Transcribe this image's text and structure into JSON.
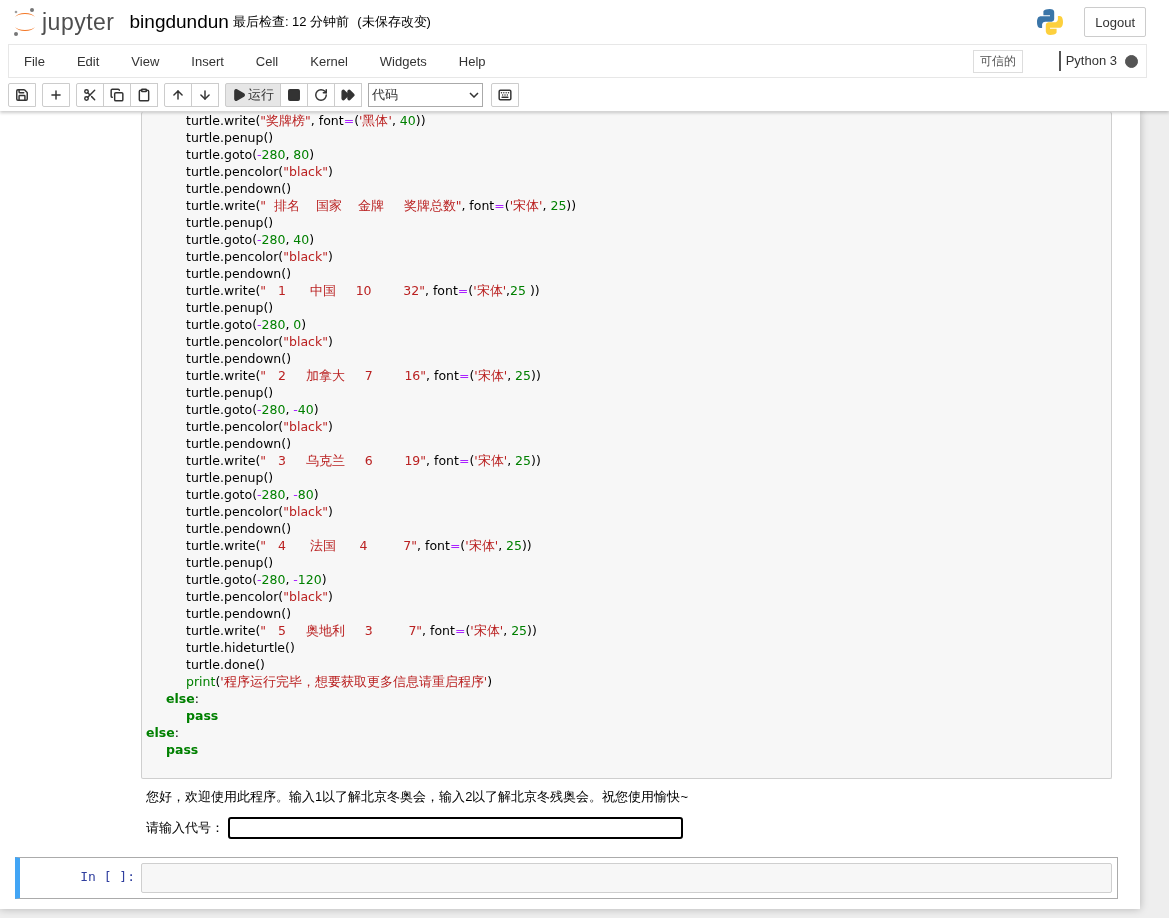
{
  "header": {
    "logo_text": "jupyter",
    "notebook_name": "bingdundun",
    "checkpoint": "最后检查: 12 分钟前",
    "autosave": "(未保存改变)",
    "logout": "Logout"
  },
  "menu": {
    "items": [
      "File",
      "Edit",
      "View",
      "Insert",
      "Cell",
      "Kernel",
      "Widgets",
      "Help"
    ],
    "trusted": "可信的",
    "kernel_name": "Python 3",
    "kernel_busy": true
  },
  "toolbar": {
    "groups": [
      [
        {
          "kind": "save"
        }
      ],
      [
        {
          "kind": "add"
        }
      ],
      [
        {
          "kind": "cut"
        },
        {
          "kind": "copy"
        },
        {
          "kind": "paste"
        }
      ],
      [
        {
          "kind": "up"
        },
        {
          "kind": "down"
        }
      ],
      [
        {
          "kind": "run",
          "label": "运行",
          "hovered": true
        },
        {
          "kind": "stop"
        },
        {
          "kind": "restart"
        },
        {
          "kind": "run-all"
        }
      ]
    ],
    "cell_type": "代码",
    "keyboard": {
      "kind": "keyboard"
    }
  },
  "cells": [
    {
      "selected": false,
      "code": [
        {
          "children": [
            {
              "children": [
                {
                  "tokens": [
                    {
                      "kind": "plain",
                      "t": "turtle.write("
                    },
                    {
                      "kind": "string",
                      "t": "\"奖牌榜\""
                    },
                    {
                      "kind": "plain",
                      "t": ", font"
                    },
                    {
                      "kind": "operator",
                      "t": "="
                    },
                    {
                      "kind": "plain",
                      "t": "("
                    },
                    {
                      "kind": "string",
                      "t": "'黑体'"
                    },
                    {
                      "kind": "plain",
                      "t": ", "
                    },
                    {
                      "kind": "number",
                      "t": "40"
                    },
                    {
                      "kind": "plain",
                      "t": "))"
                    }
                  ]
                },
                {
                  "tokens": [
                    {
                      "kind": "plain",
                      "t": "turtle.penup()"
                    }
                  ]
                },
                {
                  "tokens": [
                    {
                      "kind": "plain",
                      "t": "turtle.goto("
                    },
                    {
                      "kind": "operator",
                      "t": "-"
                    },
                    {
                      "kind": "number",
                      "t": "280"
                    },
                    {
                      "kind": "plain",
                      "t": ", "
                    },
                    {
                      "kind": "number",
                      "t": "80"
                    },
                    {
                      "kind": "plain",
                      "t": ")"
                    }
                  ]
                },
                {
                  "tokens": [
                    {
                      "kind": "plain",
                      "t": "turtle.pencolor("
                    },
                    {
                      "kind": "string",
                      "t": "\"black\""
                    },
                    {
                      "kind": "plain",
                      "t": ")"
                    }
                  ]
                },
                {
                  "tokens": [
                    {
                      "kind": "plain",
                      "t": "turtle.pendown()"
                    }
                  ]
                },
                {
                  "tokens": [
                    {
                      "kind": "plain",
                      "t": "turtle.write("
                    },
                    {
                      "kind": "string",
                      "t": "\"  排名    国家    金牌     奖牌总数\""
                    },
                    {
                      "kind": "plain",
                      "t": ", font"
                    },
                    {
                      "kind": "operator",
                      "t": "="
                    },
                    {
                      "kind": "plain",
                      "t": "("
                    },
                    {
                      "kind": "string",
                      "t": "'宋体'"
                    },
                    {
                      "kind": "plain",
                      "t": ", "
                    },
                    {
                      "kind": "number",
                      "t": "25"
                    },
                    {
                      "kind": "plain",
                      "t": "))"
                    }
                  ]
                },
                {
                  "tokens": [
                    {
                      "kind": "plain",
                      "t": "turtle.penup()"
                    }
                  ]
                },
                {
                  "tokens": [
                    {
                      "kind": "plain",
                      "t": "turtle.goto("
                    },
                    {
                      "kind": "operator",
                      "t": "-"
                    },
                    {
                      "kind": "number",
                      "t": "280"
                    },
                    {
                      "kind": "plain",
                      "t": ", "
                    },
                    {
                      "kind": "number",
                      "t": "40"
                    },
                    {
                      "kind": "plain",
                      "t": ")"
                    }
                  ]
                },
                {
                  "tokens": [
                    {
                      "kind": "plain",
                      "t": "turtle.pencolor("
                    },
                    {
                      "kind": "string",
                      "t": "\"black\""
                    },
                    {
                      "kind": "plain",
                      "t": ")"
                    }
                  ]
                },
                {
                  "tokens": [
                    {
                      "kind": "plain",
                      "t": "turtle.pendown()"
                    }
                  ]
                },
                {
                  "tokens": [
                    {
                      "kind": "plain",
                      "t": "turtle.write("
                    },
                    {
                      "kind": "string",
                      "t": "\"   1      中国     10        32\""
                    },
                    {
                      "kind": "plain",
                      "t": ", font"
                    },
                    {
                      "kind": "operator",
                      "t": "="
                    },
                    {
                      "kind": "plain",
                      "t": "("
                    },
                    {
                      "kind": "string",
                      "t": "'宋体'"
                    },
                    {
                      "kind": "plain",
                      "t": ","
                    },
                    {
                      "kind": "number",
                      "t": "25"
                    },
                    {
                      "kind": "plain",
                      "t": " ))"
                    }
                  ]
                },
                {
                  "tokens": [
                    {
                      "kind": "plain",
                      "t": "turtle.penup()"
                    }
                  ]
                },
                {
                  "tokens": [
                    {
                      "kind": "plain",
                      "t": "turtle.goto("
                    },
                    {
                      "kind": "operator",
                      "t": "-"
                    },
                    {
                      "kind": "number",
                      "t": "280"
                    },
                    {
                      "kind": "plain",
                      "t": ", "
                    },
                    {
                      "kind": "number",
                      "t": "0"
                    },
                    {
                      "kind": "plain",
                      "t": ")"
                    }
                  ]
                },
                {
                  "tokens": [
                    {
                      "kind": "plain",
                      "t": "turtle.pencolor("
                    },
                    {
                      "kind": "string",
                      "t": "\"black\""
                    },
                    {
                      "kind": "plain",
                      "t": ")"
                    }
                  ]
                },
                {
                  "tokens": [
                    {
                      "kind": "plain",
                      "t": "turtle.pendown()"
                    }
                  ]
                },
                {
                  "tokens": [
                    {
                      "kind": "plain",
                      "t": "turtle.write("
                    },
                    {
                      "kind": "string",
                      "t": "\"   2     加拿大     7        16\""
                    },
                    {
                      "kind": "plain",
                      "t": ", font"
                    },
                    {
                      "kind": "operator",
                      "t": "="
                    },
                    {
                      "kind": "plain",
                      "t": "("
                    },
                    {
                      "kind": "string",
                      "t": "'宋体'"
                    },
                    {
                      "kind": "plain",
                      "t": ", "
                    },
                    {
                      "kind": "number",
                      "t": "25"
                    },
                    {
                      "kind": "plain",
                      "t": "))"
                    }
                  ]
                },
                {
                  "tokens": [
                    {
                      "kind": "plain",
                      "t": "turtle.penup()"
                    }
                  ]
                },
                {
                  "tokens": [
                    {
                      "kind": "plain",
                      "t": "turtle.goto("
                    },
                    {
                      "kind": "operator",
                      "t": "-"
                    },
                    {
                      "kind": "number",
                      "t": "280"
                    },
                    {
                      "kind": "plain",
                      "t": ", "
                    },
                    {
                      "kind": "operator",
                      "t": "-"
                    },
                    {
                      "kind": "number",
                      "t": "40"
                    },
                    {
                      "kind": "plain",
                      "t": ")"
                    }
                  ]
                },
                {
                  "tokens": [
                    {
                      "kind": "plain",
                      "t": "turtle.pencolor("
                    },
                    {
                      "kind": "string",
                      "t": "\"black\""
                    },
                    {
                      "kind": "plain",
                      "t": ")"
                    }
                  ]
                },
                {
                  "tokens": [
                    {
                      "kind": "plain",
                      "t": "turtle.pendown()"
                    }
                  ]
                },
                {
                  "tokens": [
                    {
                      "kind": "plain",
                      "t": "turtle.write("
                    },
                    {
                      "kind": "string",
                      "t": "\"   3     乌克兰     6        19\""
                    },
                    {
                      "kind": "plain",
                      "t": ", font"
                    },
                    {
                      "kind": "operator",
                      "t": "="
                    },
                    {
                      "kind": "plain",
                      "t": "("
                    },
                    {
                      "kind": "string",
                      "t": "'宋体'"
                    },
                    {
                      "kind": "plain",
                      "t": ", "
                    },
                    {
                      "kind": "number",
                      "t": "25"
                    },
                    {
                      "kind": "plain",
                      "t": "))"
                    }
                  ]
                },
                {
                  "tokens": [
                    {
                      "kind": "plain",
                      "t": "turtle.penup()"
                    }
                  ]
                },
                {
                  "tokens": [
                    {
                      "kind": "plain",
                      "t": "turtle.goto("
                    },
                    {
                      "kind": "operator",
                      "t": "-"
                    },
                    {
                      "kind": "number",
                      "t": "280"
                    },
                    {
                      "kind": "plain",
                      "t": ", "
                    },
                    {
                      "kind": "operator",
                      "t": "-"
                    },
                    {
                      "kind": "number",
                      "t": "80"
                    },
                    {
                      "kind": "plain",
                      "t": ")"
                    }
                  ]
                },
                {
                  "tokens": [
                    {
                      "kind": "plain",
                      "t": "turtle.pencolor("
                    },
                    {
                      "kind": "string",
                      "t": "\"black\""
                    },
                    {
                      "kind": "plain",
                      "t": ")"
                    }
                  ]
                },
                {
                  "tokens": [
                    {
                      "kind": "plain",
                      "t": "turtle.pendown()"
                    }
                  ]
                },
                {
                  "tokens": [
                    {
                      "kind": "plain",
                      "t": "turtle.write("
                    },
                    {
                      "kind": "string",
                      "t": "\"   4      法国      4         7\""
                    },
                    {
                      "kind": "plain",
                      "t": ", font"
                    },
                    {
                      "kind": "operator",
                      "t": "="
                    },
                    {
                      "kind": "plain",
                      "t": "("
                    },
                    {
                      "kind": "string",
                      "t": "'宋体'"
                    },
                    {
                      "kind": "plain",
                      "t": ", "
                    },
                    {
                      "kind": "number",
                      "t": "25"
                    },
                    {
                      "kind": "plain",
                      "t": "))"
                    }
                  ]
                },
                {
                  "tokens": [
                    {
                      "kind": "plain",
                      "t": "turtle.penup()"
                    }
                  ]
                },
                {
                  "tokens": [
                    {
                      "kind": "plain",
                      "t": "turtle.goto("
                    },
                    {
                      "kind": "operator",
                      "t": "-"
                    },
                    {
                      "kind": "number",
                      "t": "280"
                    },
                    {
                      "kind": "plain",
                      "t": ", "
                    },
                    {
                      "kind": "operator",
                      "t": "-"
                    },
                    {
                      "kind": "number",
                      "t": "120"
                    },
                    {
                      "kind": "plain",
                      "t": ")"
                    }
                  ]
                },
                {
                  "tokens": [
                    {
                      "kind": "plain",
                      "t": "turtle.pencolor("
                    },
                    {
                      "kind": "string",
                      "t": "\"black\""
                    },
                    {
                      "kind": "plain",
                      "t": ")"
                    }
                  ]
                },
                {
                  "tokens": [
                    {
                      "kind": "plain",
                      "t": "turtle.pendown()"
                    }
                  ]
                },
                {
                  "tokens": [
                    {
                      "kind": "plain",
                      "t": "turtle.write("
                    },
                    {
                      "kind": "string",
                      "t": "\"   5     奥地利     3         7\""
                    },
                    {
                      "kind": "plain",
                      "t": ", font"
                    },
                    {
                      "kind": "operator",
                      "t": "="
                    },
                    {
                      "kind": "plain",
                      "t": "("
                    },
                    {
                      "kind": "string",
                      "t": "'宋体'"
                    },
                    {
                      "kind": "plain",
                      "t": ", "
                    },
                    {
                      "kind": "number",
                      "t": "25"
                    },
                    {
                      "kind": "plain",
                      "t": "))"
                    }
                  ]
                },
                {
                  "tokens": [
                    {
                      "kind": "plain",
                      "t": "turtle.hideturtle()"
                    }
                  ]
                },
                {
                  "tokens": [
                    {
                      "kind": "plain",
                      "t": "turtle.done()"
                    }
                  ]
                },
                {
                  "tokens": [
                    {
                      "kind": "builtin",
                      "t": "print"
                    },
                    {
                      "kind": "plain",
                      "t": "("
                    },
                    {
                      "kind": "string",
                      "t": "'程序运行完毕，想要获取更多信息请重启程序'"
                    },
                    {
                      "kind": "plain",
                      "t": ")"
                    }
                  ]
                }
              ]
            },
            {
              "tokens": [
                {
                  "kind": "keyword",
                  "t": "else"
                },
                {
                  "kind": "plain",
                  "t": ":"
                }
              ],
              "children": [
                {
                  "tokens": [
                    {
                      "kind": "keyword",
                      "t": "pass"
                    }
                  ]
                }
              ]
            }
          ]
        },
        {
          "tokens": [
            {
              "kind": "keyword",
              "t": "else"
            },
            {
              "kind": "plain",
              "t": ":"
            }
          ],
          "children": [
            {
              "tokens": [
                {
                  "kind": "keyword",
                  "t": "pass"
                }
              ]
            }
          ]
        }
      ],
      "output": {
        "text": "您好，欢迎使用此程序。输入1以了解北京冬奥会，输入2以了解北京冬残奥会。祝您使用愉快~",
        "input_label": "请输入代号："
      }
    },
    {
      "selected": true,
      "prompt": "In [ ]:"
    }
  ]
}
